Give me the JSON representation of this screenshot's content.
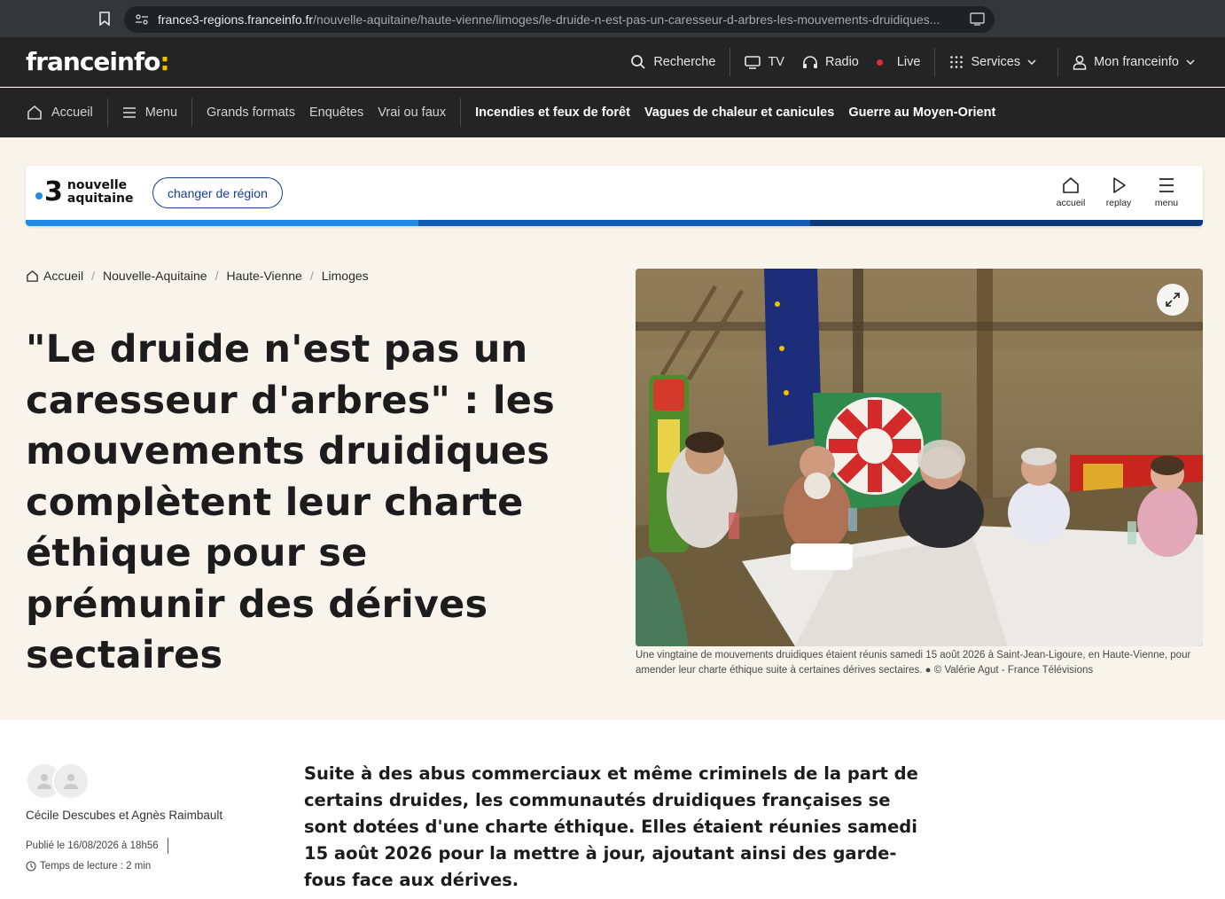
{
  "browser": {
    "url_host": "france3-regions.franceinfo.fr",
    "url_path": "/nouvelle-aquitaine/haute-vienne/limoges/le-druide-n-est-pas-un-caresseur-d-arbres-les-mouvements-druidiques..."
  },
  "header": {
    "logo_text": "franceinfo",
    "logo_colon": ":",
    "top_nav": {
      "search": "Recherche",
      "tv": "TV",
      "radio": "Radio",
      "live": "Live",
      "services": "Services",
      "account": "Mon franceinfo"
    },
    "nav": {
      "home": "Accueil",
      "menu": "Menu",
      "links": [
        "Grands formats",
        "Enquêtes",
        "Vrai ou faux"
      ],
      "topics": [
        "Incendies et feux de forêt",
        "Vagues de chaleur et canicules",
        "Guerre au Moyen-Orient"
      ]
    }
  },
  "region": {
    "logo_number": "3",
    "name_line1": "nouvelle",
    "name_line2": "aquitaine",
    "change_button": "changer de région",
    "actions": {
      "home": "accueil",
      "replay": "replay",
      "menu": "menu"
    },
    "stripe_colors": [
      "#1e8ae6",
      "#0f5bb5",
      "#0a3a7a"
    ]
  },
  "breadcrumb": [
    "Accueil",
    "Nouvelle-Aquitaine",
    "Haute-Vienne",
    "Limoges"
  ],
  "article": {
    "title": "\"Le druide n'est pas un caresseur d'arbres\" : les mouvements druidiques complètent leur charte éthique pour se prémunir des dérives sectaires",
    "photo_caption": "Une vingtaine de mouvements druidiques étaient réunis samedi 15 août 2026 à Saint-Jean-Ligoure, en Haute-Vienne, pour amender leur charte éthique suite à certaines dérives sectaires. ● © Valérie Agut - France Télévisions",
    "authors": "Cécile Descubes et Agnès Raimbault",
    "published": "Publié le 16/08/2026 à 18h56",
    "reading_time": "Temps de lecture : 2 min",
    "chapo": "Suite à des abus commerciaux et même criminels de la part de certains druides, les communautés druidiques françaises se sont dotées d'une charte éthique. Elles étaient réunies samedi 15 août 2026 pour la mettre à jour, ajoutant ainsi des garde-fous face aux dérives."
  },
  "colors": {
    "header_bg": "#242424",
    "page_bg": "#f8f4ec",
    "accent_yellow": "#f2c200",
    "region_blue": "#1a3d8f",
    "live_red": "#e62d2d"
  }
}
